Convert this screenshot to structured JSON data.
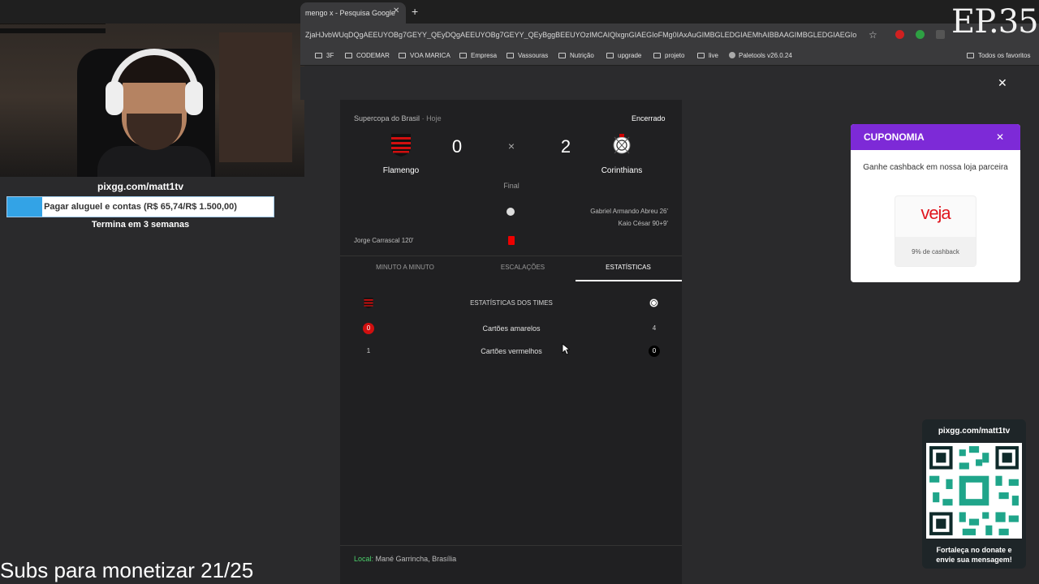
{
  "browser": {
    "tab_title": "mengo x - Pesquisa Google",
    "tab_close": "✕",
    "new_tab": "+",
    "url": "ZjaHJvbWUqDQgAEEUYOBg7GEYY_QEyDQgAEEUYOBg7GEYY_QEyBggBEEUYOzIMCAIQlxgnGIAEGIoFMg0IAxAuGIMBGLEDGIAEMhAIBBAAGIMBGLEDGIAEGIoFMgYIB...",
    "bookmarks": [
      "3F",
      "CODEMAR",
      "VOA MARICA",
      "Empresa",
      "Vassouras",
      "Nutrição",
      "upgrade",
      "projeto",
      "live",
      "Paletools v26.0.24"
    ],
    "all_bookmarks": "Todos os favoritos",
    "episode_badge": "EP.35"
  },
  "overlay": {
    "close": "✕"
  },
  "stream": {
    "pix_url": "pixgg.com/matt1tv",
    "goal_label": "Pagar aluguel e contas (R$ 65,74/R$ 1.500,00)",
    "goal_progress": 0.044,
    "goal_deadline": "Termina em 3 semanas",
    "subs_text": "Subs para monetizar 21/25",
    "qr_url": "pixgg.com/matt1tv",
    "qr_caption_1": "Fortaleça no donate e",
    "qr_caption_2": "envie sua mensagem!"
  },
  "match": {
    "competition": "Supercopa do Brasil",
    "separator": " · ",
    "day": "Hoje",
    "status": "Encerrado",
    "home_team": "Flamengo",
    "away_team": "Corinthians",
    "home_score": "0",
    "away_score": "2",
    "vs_symbol": "×",
    "period": "Final",
    "scorer_1": "Gabriel Armando Abreu 26'",
    "scorer_2": "Kaio César 90+9'",
    "red_card_player": "Jorge Carrascal 120'",
    "tabs": [
      "MINUTO A MINUTO",
      "ESCALAÇÕES",
      "ESTATÍSTICAS"
    ],
    "active_tab": "ESTATÍSTICAS",
    "stats_title": "ESTATÍSTICAS DOS TIMES",
    "stats": [
      {
        "label": "Cartões amarelos",
        "home": "0",
        "away": "4"
      },
      {
        "label": "Cartões vermelhos",
        "home": "1",
        "away": "0"
      }
    ],
    "venue_label": "Local:",
    "venue": "Mané Garrincha, Brasília",
    "colors": {
      "home_red": "#d10f0f",
      "home_black": "#111111",
      "accent_green": "#4bd16b"
    }
  },
  "coupon": {
    "title": "CUPONOMIA",
    "close": "✕",
    "text": "Ganhe cashback em nossa loja parceira",
    "brand": "veja",
    "cashback": "9% de cashback",
    "accent": "#7d2ad7"
  }
}
